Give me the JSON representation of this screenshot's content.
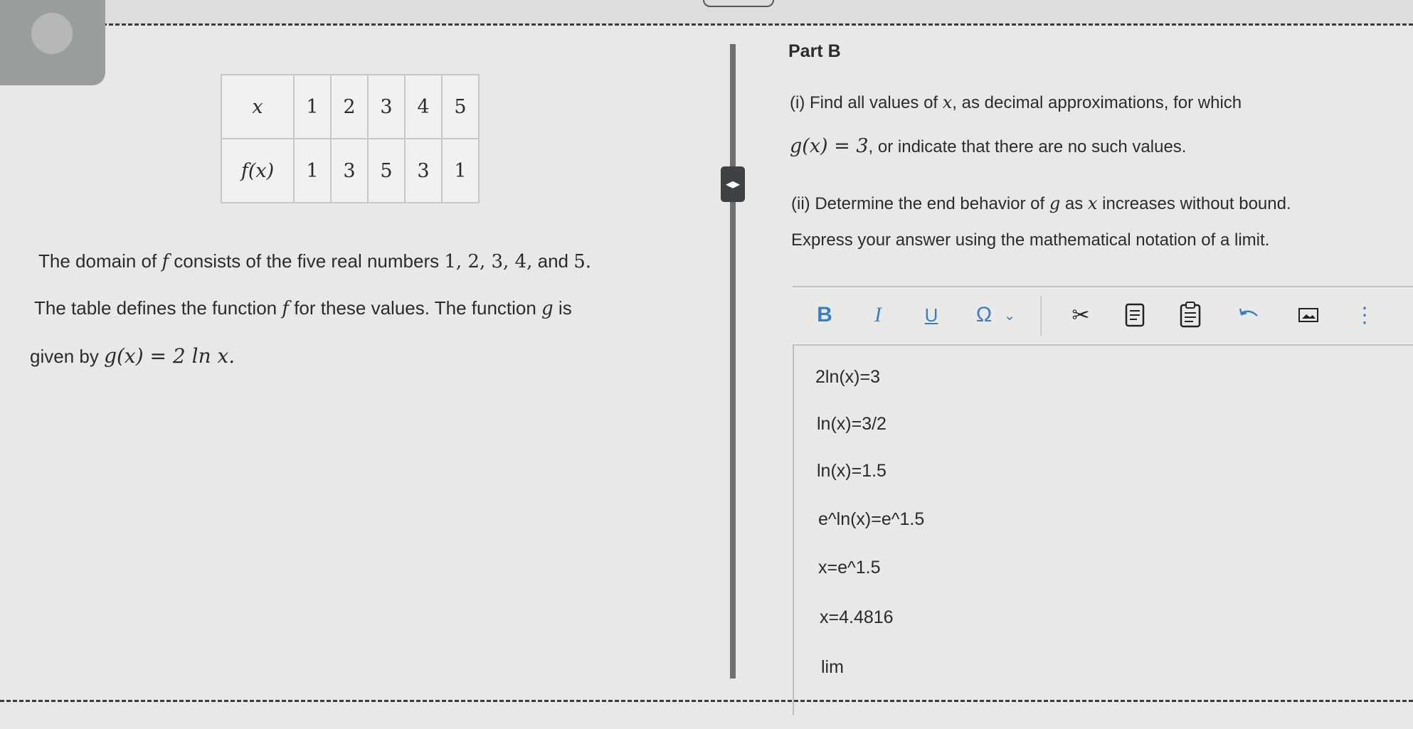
{
  "table": {
    "row1_label": "x",
    "row1_values": [
      "1",
      "2",
      "3",
      "4",
      "5"
    ],
    "row2_label": "f(x)",
    "row2_values": [
      "1",
      "3",
      "5",
      "3",
      "1"
    ]
  },
  "left_text": {
    "domain_pre": "The domain of ",
    "domain_f": "f",
    "domain_post": " consists of the five real numbers ",
    "domain_nums": "1, 2, 3, 4,",
    "domain_and": " and ",
    "domain_last": "5.",
    "table_pre": "The table defines the function ",
    "table_f": "f",
    "table_mid": " for these values. The function ",
    "table_g": "g",
    "table_post": " is",
    "given_pre": "given by ",
    "given_formula": "g(x) = 2 ln x."
  },
  "part": {
    "title": "Part B",
    "q1_a_pre": "(i) Find all values of ",
    "q1_a_x": "x",
    "q1_a_post": ", as decimal approximations, for which",
    "q1_b_formula": "g(x) = 3",
    "q1_b_post": ", or indicate that there are no such values.",
    "q2_pre": "(ii) Determine the end behavior of ",
    "q2_g": "g",
    "q2_mid": " as ",
    "q2_x": "x",
    "q2_post": " increases without bound.",
    "q2_line2": "Express your answer using the mathematical notation of a limit."
  },
  "toolbar": {
    "bold": "B",
    "italic": "I",
    "underline": "U",
    "omega": "Ω",
    "more": "⋮"
  },
  "answer_lines": [
    "2ln(x)=3",
    "ln(x)=3/2",
    "ln(x)=1.5",
    "e^ln(x)=e^1.5",
    "x=e^1.5",
    "x=4.4816",
    "lim"
  ],
  "colors": {
    "accent": "#3a7fc4",
    "background": "#e8e9e7"
  },
  "icons": [
    "expand-collapse-icon",
    "bold-icon",
    "italic-icon",
    "underline-icon",
    "special-characters-icon",
    "chevron-down-icon",
    "cut-icon",
    "copy-icon",
    "paste-icon",
    "undo-icon",
    "image-icon",
    "more-options-icon"
  ]
}
